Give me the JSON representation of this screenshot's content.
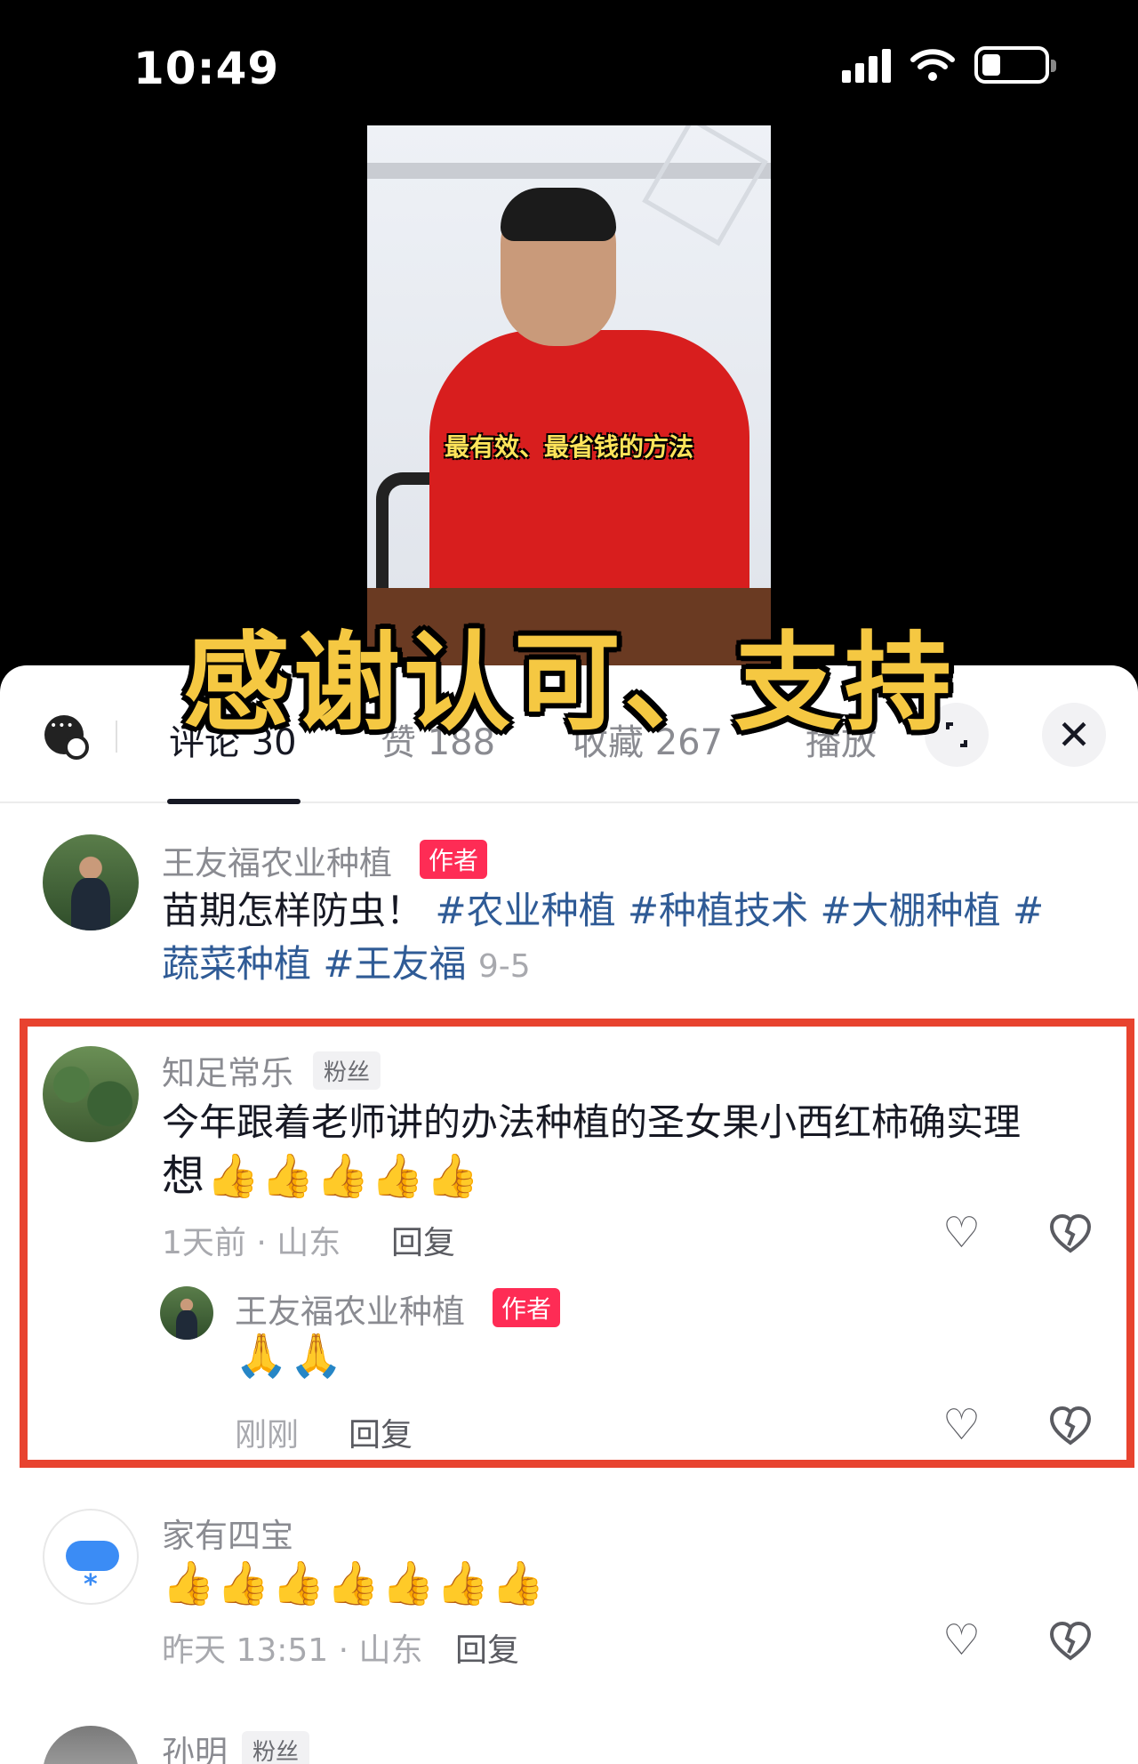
{
  "status_bar": {
    "time": "10:49"
  },
  "video": {
    "caption": "最有效、最省钱的方法"
  },
  "overlay_title": "感谢认可、支持",
  "tabs": {
    "comments": "评论 30",
    "likes": "赞 188",
    "favorites": "收藏 267",
    "plays": "播放"
  },
  "close_symbol": "✕",
  "post": {
    "author": "王友福农业种植",
    "author_badge": "作者",
    "text_plain": "苗期怎样防虫！",
    "hashtags_line1": "#农业种植 #种植技术 #大棚种植 #",
    "hashtags_line2": "蔬菜种植 #王友福",
    "date": "9-5"
  },
  "comments": [
    {
      "user": "知足常乐",
      "badge": "粉丝",
      "text_line1": "今年跟着老师讲的办法种植的圣女果小西红柿确实理",
      "text_line2": "想👍👍👍👍👍",
      "meta": "1天前 · 山东",
      "reply_label": "回复",
      "reply": {
        "user": "王友福农业种植",
        "badge": "作者",
        "text": "🙏🙏",
        "meta": "刚刚",
        "reply_label": "回复"
      }
    },
    {
      "user": "家有四宝",
      "text": "👍👍👍👍👍👍👍",
      "meta": "昨天 13:51 · 山东",
      "reply_label": "回复"
    },
    {
      "user": "孙明",
      "badge": "粉丝"
    }
  ],
  "icons": {
    "like": "heart-outline-icon",
    "dislike": "broken-heart-icon"
  },
  "colors": {
    "highlight_box": "#e8432f",
    "author_badge": "#fe2c55",
    "hashtag": "#2f5b96",
    "overlay_text": "#f5c842"
  }
}
